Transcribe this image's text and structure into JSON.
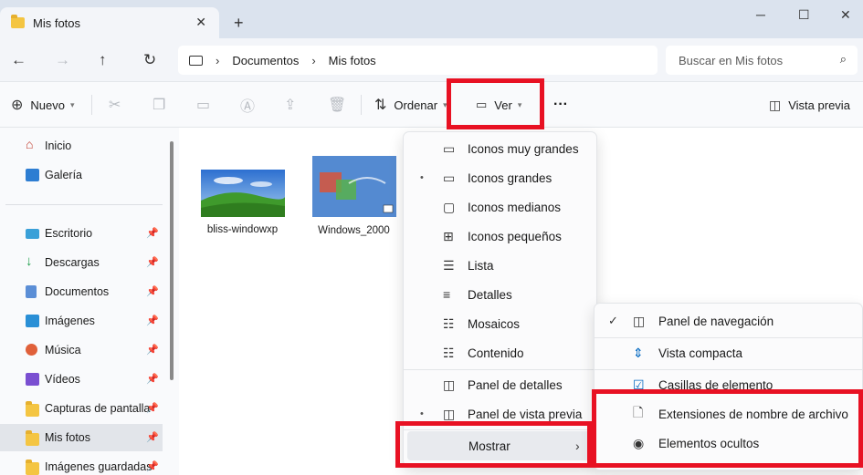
{
  "window": {
    "tab_title": "Mis fotos",
    "close_glyph": "✕",
    "newtab_glyph": "+",
    "minimize_glyph": "─",
    "maximize_glyph": "☐",
    "close_window_glyph": "✕"
  },
  "address": {
    "segments": [
      "Documentos",
      "Mis fotos"
    ],
    "separator": "›",
    "search_placeholder": "Buscar en Mis fotos"
  },
  "toolbar": {
    "new_label": "Nuevo",
    "sort_label": "Ordenar",
    "view_label": "Ver",
    "more_label": "···",
    "preview_label": "Vista previa"
  },
  "sidebar": {
    "items": [
      {
        "label": "Inicio",
        "icon": "home-icon"
      },
      {
        "label": "Galería",
        "icon": "gallery-icon"
      },
      {
        "label": "Escritorio",
        "icon": "desktop-icon"
      },
      {
        "label": "Descargas",
        "icon": "downloads-icon"
      },
      {
        "label": "Documentos",
        "icon": "documents-icon"
      },
      {
        "label": "Imágenes",
        "icon": "pictures-icon"
      },
      {
        "label": "Música",
        "icon": "music-icon"
      },
      {
        "label": "Vídeos",
        "icon": "videos-icon"
      },
      {
        "label": "Capturas de pantalla",
        "icon": "folder-icon"
      },
      {
        "label": "Mis fotos",
        "icon": "folder-icon"
      },
      {
        "label": "Imágenes guardadas",
        "icon": "folder-icon"
      }
    ],
    "pin_glyph": "📌"
  },
  "files": [
    {
      "name": "bliss-windowxp"
    },
    {
      "name": "Windows_2000"
    }
  ],
  "view_menu": {
    "items": [
      {
        "label": "Iconos muy grandes",
        "selected": false
      },
      {
        "label": "Iconos grandes",
        "selected": true
      },
      {
        "label": "Iconos medianos",
        "selected": false
      },
      {
        "label": "Iconos pequeños",
        "selected": false
      },
      {
        "label": "Lista",
        "selected": false
      },
      {
        "label": "Detalles",
        "selected": false
      },
      {
        "label": "Mosaicos",
        "selected": false
      },
      {
        "label": "Contenido",
        "selected": false
      }
    ],
    "panes": [
      {
        "label": "Panel de detalles",
        "selected": false
      },
      {
        "label": "Panel de vista previa",
        "selected": true
      }
    ],
    "show_label": "Mostrar",
    "submenu_glyph": "›",
    "selected_glyph": "•"
  },
  "show_menu": {
    "items": [
      {
        "label": "Panel de navegación",
        "checked": true
      },
      {
        "label": "Vista compacta",
        "checked": false
      },
      {
        "label": "Casillas de elemento",
        "checked": false
      },
      {
        "label": "Extensiones de nombre de archivo",
        "checked": false
      },
      {
        "label": "Elementos ocultos",
        "checked": false
      }
    ],
    "check_glyph": "✓"
  },
  "colors": {
    "highlight": "#e81123",
    "accent": "#0067c0"
  }
}
